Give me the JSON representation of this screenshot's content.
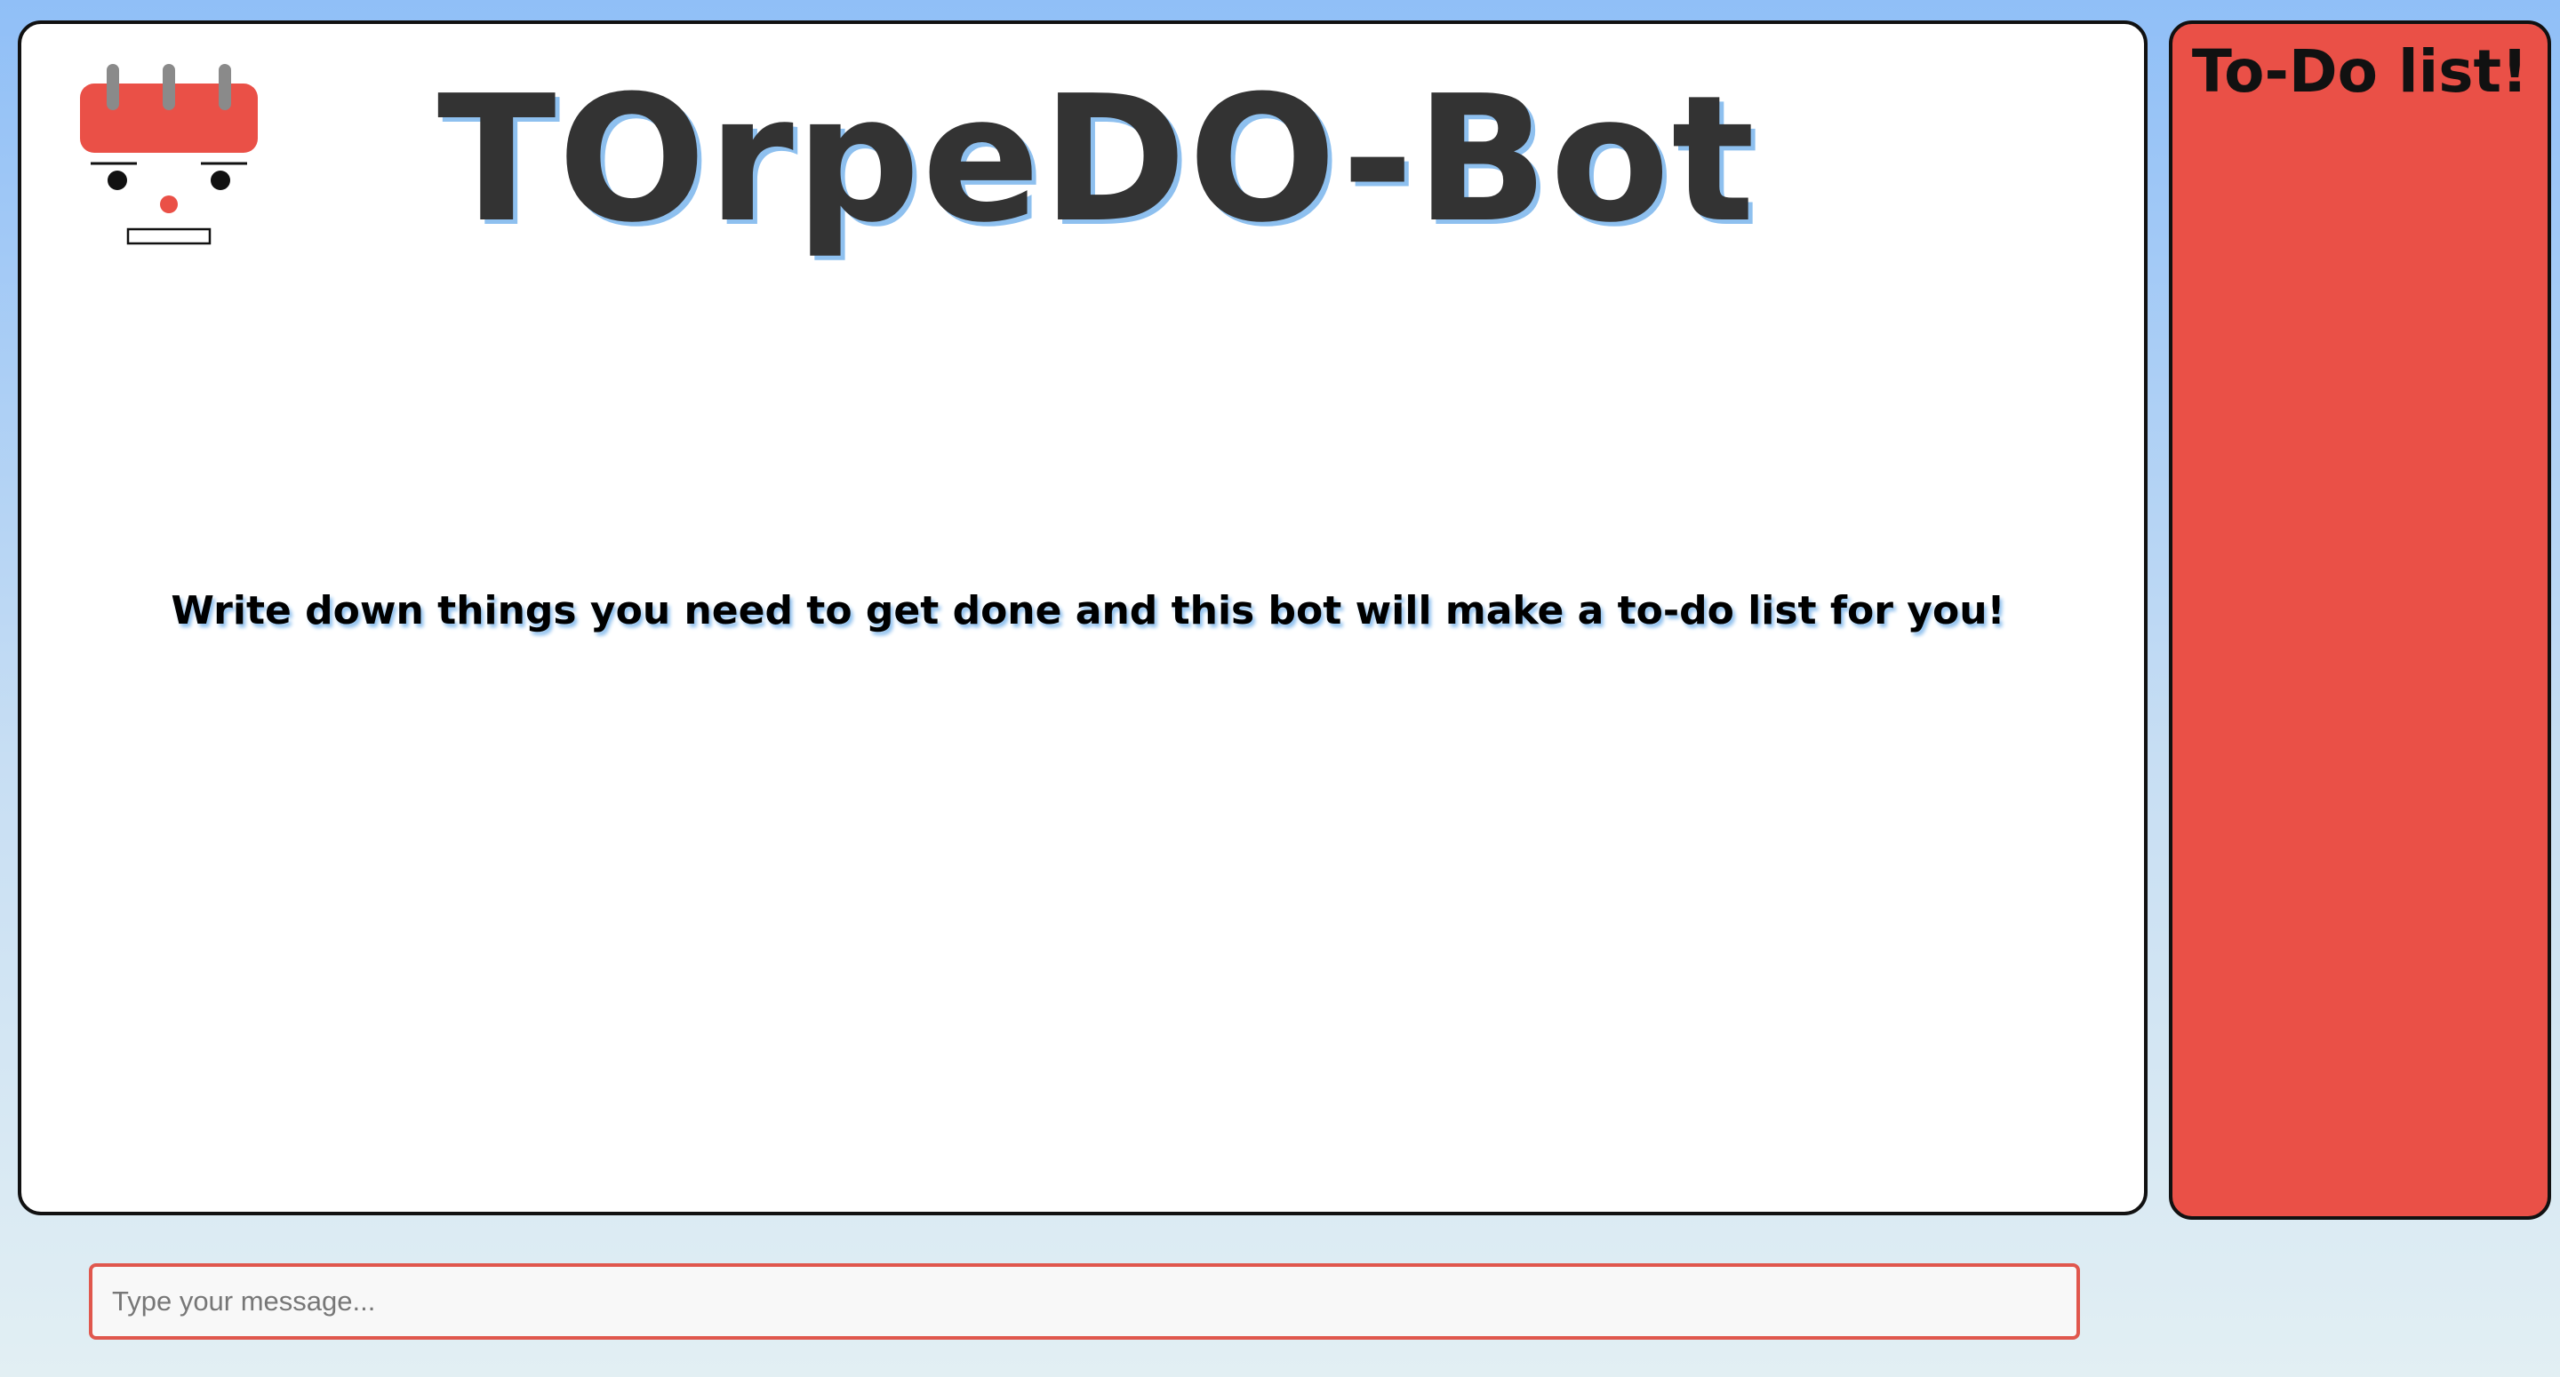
{
  "app": {
    "title": "TOrpeDO-Bot",
    "intro": "Write down things you need to get done and this bot will make a to-do list for you!"
  },
  "todo": {
    "heading": "To-Do list!",
    "items": []
  },
  "composer": {
    "placeholder": "Type your message...",
    "value": ""
  },
  "icons": {
    "avatar": "calendar-robot-icon"
  },
  "colors": {
    "background_top": "#90bff7",
    "background_bottom": "#e2eff3",
    "title_text": "#333333",
    "title_shadow": "#8ec0ef",
    "todo_panel": "#ea5047",
    "input_border": "#e0574d",
    "calendar_top": "#ea5047"
  }
}
